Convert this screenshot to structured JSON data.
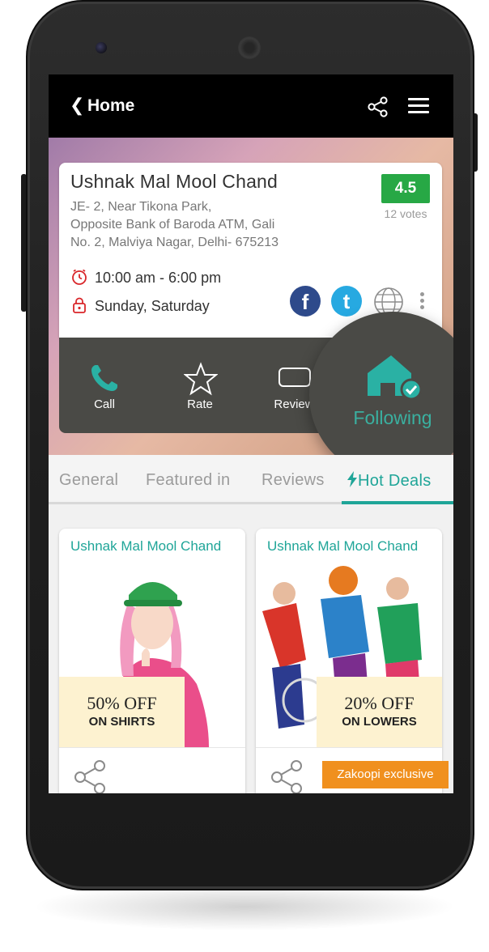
{
  "appbar": {
    "back_icon": "chevron-left-icon",
    "title": "Home",
    "share_icon": "share-icon",
    "menu_icon": "hamburger-menu-icon"
  },
  "business": {
    "name": "Ushnak Mal Mool Chand",
    "rating": "4.5",
    "votes": "12 votes",
    "address_lines": [
      "JE- 2, Near Tikona Park,",
      "Opposite Bank of Baroda ATM, Gali",
      "No. 2,  Malviya Nagar, Delhi- 675213"
    ],
    "hours": "10:00 am - 6:00 pm",
    "days": "Sunday, Saturday"
  },
  "actions": {
    "call": "Call",
    "rate": "Rate",
    "review": "Review",
    "following": "Following"
  },
  "tabs": [
    {
      "label": "General"
    },
    {
      "label": "Featured in"
    },
    {
      "label": "Reviews"
    },
    {
      "label": "Hot Deals",
      "active": true
    }
  ],
  "deals": [
    {
      "store": "Ushnak Mal Mool Chand",
      "offer": "50% OFF",
      "offer_sub": "ON SHIRTS"
    },
    {
      "store": "Ushnak Mal Mool Chand",
      "offer": "20% OFF",
      "offer_sub": "ON LOWERS",
      "badge": "Zakoopi exclusive"
    }
  ],
  "colors": {
    "accent": "#1fa598",
    "rating_green": "#27a845",
    "facebook": "#2e4a8b",
    "twitter": "#27a9e1",
    "badge_orange": "#f0901e"
  }
}
